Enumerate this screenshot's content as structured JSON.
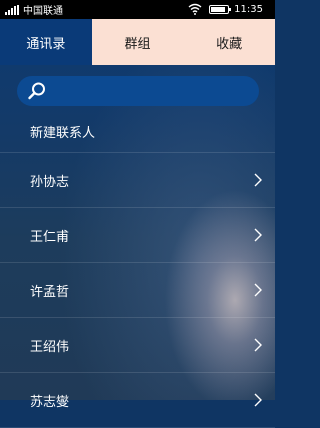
{
  "status_bar": {
    "carrier": "中国联通",
    "time": "11:35",
    "battery_level": 0.85
  },
  "tabs": [
    {
      "label": "通讯录",
      "active": true
    },
    {
      "label": "群组",
      "active": false
    },
    {
      "label": "收藏",
      "active": false
    }
  ],
  "search": {
    "placeholder": "",
    "icon": "search-icon"
  },
  "list": {
    "new_contact_label": "新建联系人",
    "contacts": [
      {
        "name": "孙协志"
      },
      {
        "name": "王仁甫"
      },
      {
        "name": "许孟哲"
      },
      {
        "name": "王绍伟"
      },
      {
        "name": "苏志燮"
      }
    ]
  },
  "colors": {
    "tab_active_bg": "#0a3a78",
    "tab_inactive_bg": "#fbe0d3",
    "search_bg": "#0c4a92"
  }
}
